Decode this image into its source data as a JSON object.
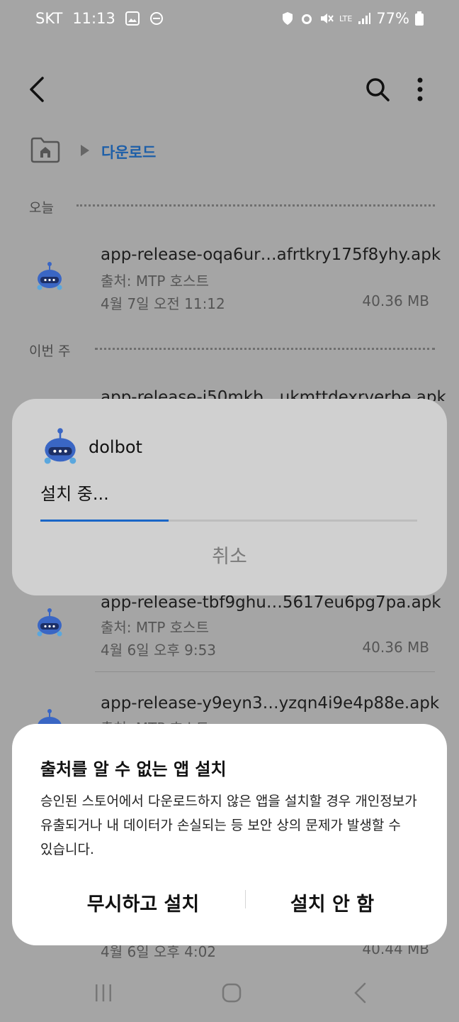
{
  "status": {
    "carrier": "SKT",
    "time": "11:13",
    "network": "LTE",
    "battery": "77%"
  },
  "breadcrumb": {
    "folder": "다운로드"
  },
  "sections": {
    "today": "오늘",
    "this_week": "이번 주"
  },
  "files": [
    {
      "name": "app-release-oqa6ur…afrtkry175f8yhy.apk",
      "source": "출처: MTP 호스트",
      "date": "4월 7일 오전 11:12",
      "size": "40.36 MB"
    },
    {
      "name": "app-release-i50mkb…ukmttdexrverbe.apk"
    },
    {
      "name": "app-release-tbf9ghu…5617eu6pg7pa.apk",
      "source": "출처: MTP 호스트",
      "date": "4월 6일 오후 9:53",
      "size": "40.36 MB"
    },
    {
      "name": "app-release-y9eyn3…yzqn4i9e4p88e.apk",
      "source": "출처: MTP 호스트",
      "date": "4월 6일 오후 4:02",
      "size": "40.44 MB"
    }
  ],
  "install_dialog": {
    "app_name": "dolbot",
    "status": "설치 중...",
    "progress": 0.34,
    "cancel_label": "취소"
  },
  "unknown_source_dialog": {
    "title": "출처를 알 수 없는 앱 설치",
    "body": "승인된 스토어에서 다운로드하지 않은 앱을 설치할 경우 개인정보가 유출되거나 내 데이터가 손실되는 등 보안 상의 문제가 발생할 수 있습니다.",
    "ignore_label": "무시하고 설치",
    "dont_install_label": "설치 안 함"
  },
  "colors": {
    "accent": "#1e5fa8",
    "progress": "#1a66c7",
    "scrim": "#a5a5a5"
  }
}
